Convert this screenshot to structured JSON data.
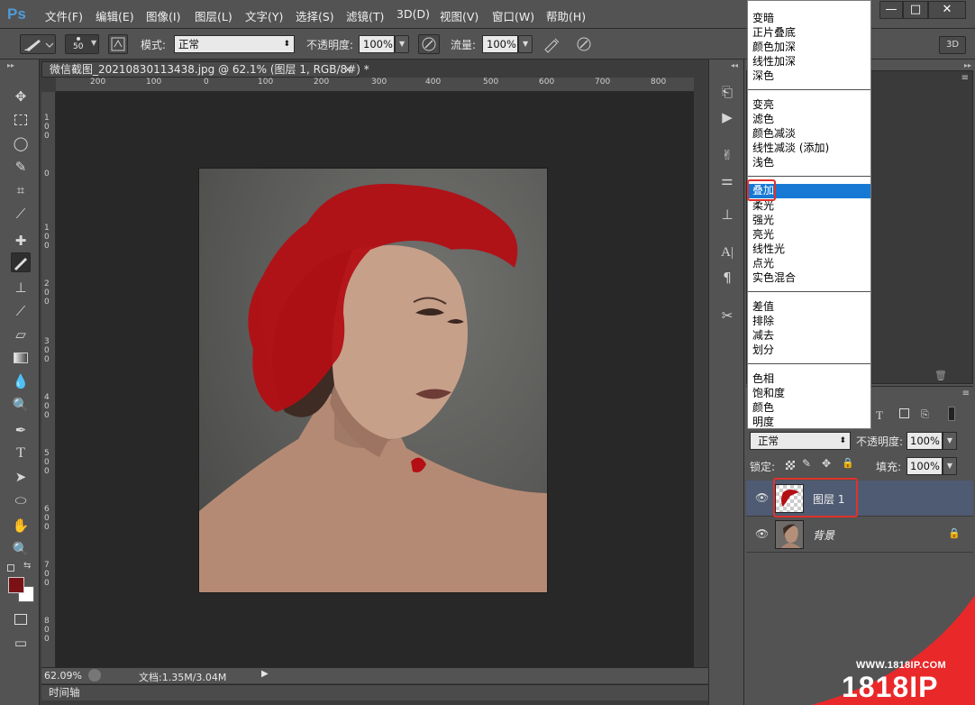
{
  "app": {
    "logo": "Ps"
  },
  "menubar": {
    "items": [
      "文件(F)",
      "编辑(E)",
      "图像(I)",
      "图层(L)",
      "文字(Y)",
      "选择(S)",
      "滤镜(T)",
      "3D(D)",
      "视图(V)",
      "窗口(W)",
      "帮助(H)"
    ],
    "window_buttons": [
      "—",
      "□",
      "✕"
    ]
  },
  "options_bar": {
    "brush_size": "50",
    "mode_label": "模式:",
    "mode_value": "正常",
    "opacity_label": "不透明度:",
    "opacity_value": "100%",
    "flow_label": "流量:",
    "flow_value": "100%",
    "workspace_button": "3D"
  },
  "document": {
    "tab_title": "微信截图_20210830113438.jpg @ 62.1% (图层 1, RGB/8#) *",
    "tab_close": "×",
    "ruler_h_ticks": [
      "200",
      "100",
      "0",
      "100",
      "200",
      "300",
      "400",
      "500",
      "600",
      "700",
      "800"
    ],
    "ruler_v_ticks": [
      "1 0 0",
      "0",
      "1 0 0",
      "2 0 0",
      "3 0 0",
      "4 0 0",
      "5 0 0",
      "6 0 0",
      "7 0 0",
      "8 0 0"
    ]
  },
  "status": {
    "zoom": "62.09%",
    "doc_info": "文档:1.35M/3.04M",
    "timeline": "时间轴"
  },
  "colors": {
    "foreground": "#7a1114",
    "background": "#ffffff",
    "highlight_red": "#e0312b",
    "selection_blue": "#1779d4"
  },
  "blend_menu": {
    "groups": [
      [
        "变暗",
        "正片叠底",
        "颜色加深",
        "线性加深",
        "深色"
      ],
      [
        "变亮",
        "滤色",
        "颜色减淡",
        "线性减淡 (添加)",
        "浅色"
      ],
      [
        "叠加",
        "柔光",
        "强光",
        "亮光",
        "线性光",
        "点光",
        "实色混合"
      ],
      [
        "差值",
        "排除",
        "减去",
        "划分"
      ],
      [
        "色相",
        "饱和度",
        "颜色",
        "明度"
      ]
    ],
    "selected": "叠加"
  },
  "layers_panel": {
    "blend_mode": "正常",
    "opacity_label": "不透明度:",
    "opacity_value": "100%",
    "lock_label": "锁定:",
    "fill_label": "填充:",
    "fill_value": "100%",
    "layers": [
      {
        "name": "图层 1",
        "selected": true
      },
      {
        "name": "背景",
        "selected": false
      }
    ]
  },
  "watermark": {
    "url": "WWW.1818IP.COM",
    "brand": "1818IP"
  }
}
